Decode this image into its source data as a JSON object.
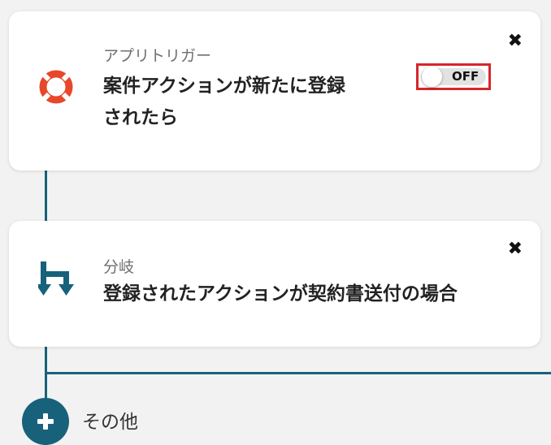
{
  "trigger_card": {
    "label": "アプリトリガー",
    "title": "案件アクションが新たに登録されたら",
    "toggle_state": "OFF",
    "close_symbol": "✖",
    "icon": "lifebuoy-icon",
    "icon_color": "#e8482a"
  },
  "branch_card": {
    "label": "分岐",
    "title": "登録されたアクションが契約書送付の場合",
    "close_symbol": "✖",
    "icon": "branch-icon",
    "icon_color": "#17627a"
  },
  "add_step": {
    "icon": "plus-icon",
    "label": "その他"
  },
  "colors": {
    "accent": "#17627a",
    "highlight_border": "#d7262b",
    "background": "#f2f2f2"
  }
}
